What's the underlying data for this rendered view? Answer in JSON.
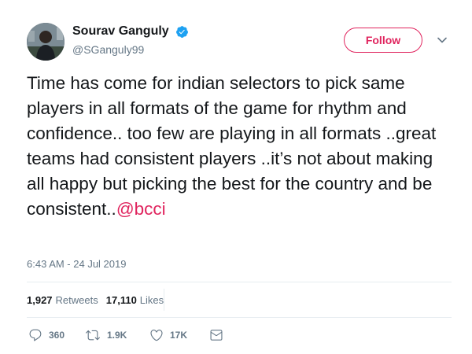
{
  "author": {
    "name": "Sourav Ganguly",
    "handle": "@SGanguly99",
    "verified": true
  },
  "follow_button": {
    "label": "Follow"
  },
  "tweet": {
    "text": "Time has come for indian selectors to pick same players in all formats of the game for rhythm and confidence.. too few are playing in all formats ..great teams had consistent players ..it’s not about making all happy but picking the best for the country and be consistent..",
    "mention": "@bcci",
    "timestamp": "6:43 AM - 24 Jul 2019"
  },
  "stats": {
    "retweets_count": "1,927",
    "retweets_label": "Retweets",
    "likes_count": "17,110",
    "likes_label": "Likes"
  },
  "actions": {
    "reply_count": "360",
    "retweet_count": "1.9K",
    "like_count": "17K"
  },
  "icons": {
    "verified": "verified-badge-icon",
    "caret": "chevron-down-icon",
    "reply": "reply-icon",
    "retweet": "retweet-icon",
    "like": "heart-icon",
    "message": "envelope-icon"
  },
  "colors": {
    "accent": "#e0245e",
    "verified": "#1da1f2",
    "secondary_text": "#657786",
    "primary_text": "#14171a"
  }
}
